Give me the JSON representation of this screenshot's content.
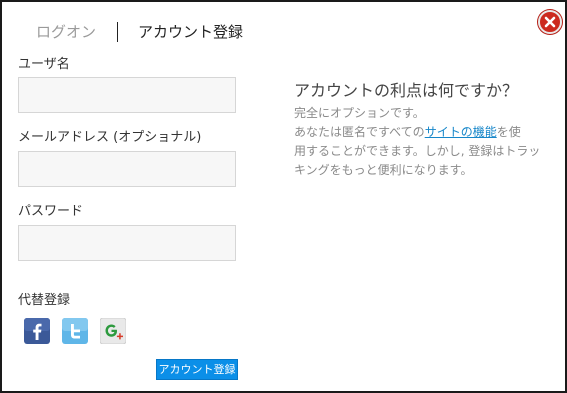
{
  "tabs": {
    "login": "ログオン",
    "register": "アカウント登録"
  },
  "fields": {
    "username": {
      "label": "ユーザ名",
      "value": ""
    },
    "email": {
      "label": "メールアドレス (オプショナル)",
      "value": ""
    },
    "password": {
      "label": "パスワード",
      "value": ""
    }
  },
  "social": {
    "label": "代替登録",
    "items": [
      {
        "icon": "facebook-icon",
        "color": "#3b5998"
      },
      {
        "icon": "twitter-icon",
        "color": "#5fb6e8"
      },
      {
        "icon": "google-icon",
        "color": "#e9e9e9"
      }
    ]
  },
  "submit_label": "アカウント登録",
  "info": {
    "title": "アカウントの利点は何ですか？",
    "line1": "完全にオプションです。",
    "line2_before": "あなたは匿名ですべての",
    "line2_link": "サイトの機能",
    "line2_after": "を使",
    "line3": "用することができます。しかし, 登録はトラッ",
    "line4": "キングをもっと便利になります。"
  },
  "colors": {
    "accent": "#0b8fe8",
    "close": "#cc2a1f",
    "link": "#1686c9"
  }
}
